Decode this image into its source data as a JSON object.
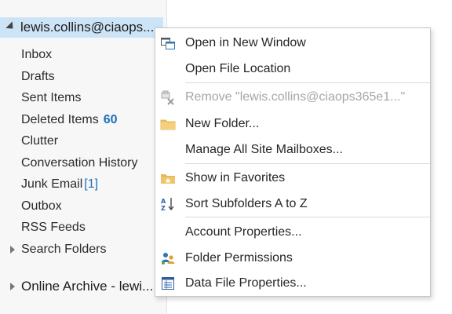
{
  "account": {
    "name": "lewis.collins@ciaops..."
  },
  "folders": [
    {
      "label": "Inbox",
      "badge": "",
      "badge_style": ""
    },
    {
      "label": "Drafts",
      "badge": "",
      "badge_style": ""
    },
    {
      "label": "Sent Items",
      "badge": "",
      "badge_style": ""
    },
    {
      "label": "Deleted Items",
      "badge": "60",
      "badge_style": "bold"
    },
    {
      "label": "Clutter",
      "badge": "",
      "badge_style": ""
    },
    {
      "label": "Conversation History",
      "badge": "",
      "badge_style": ""
    },
    {
      "label": "Junk Email",
      "badge": "[1]",
      "badge_style": "bracket"
    },
    {
      "label": "Outbox",
      "badge": "",
      "badge_style": ""
    },
    {
      "label": "RSS Feeds",
      "badge": "",
      "badge_style": ""
    },
    {
      "label": "Search Folders",
      "badge": "",
      "badge_style": ""
    }
  ],
  "archive": {
    "name": "Online Archive - lewi..."
  },
  "context_menu": {
    "items": [
      {
        "label": "Open in New Window",
        "icon": "new-window-icon",
        "disabled": false
      },
      {
        "label": "Open File Location",
        "icon": "",
        "disabled": false
      },
      {
        "label": "Remove \"lewis.collins@ciaops365e1...\"",
        "icon": "remove-mailbox-icon",
        "disabled": true
      },
      {
        "label": "New Folder...",
        "icon": "folder-icon",
        "disabled": false
      },
      {
        "label": "Manage All Site Mailboxes...",
        "icon": "",
        "disabled": false
      },
      {
        "label": "Show in Favorites",
        "icon": "favorites-folder-icon",
        "disabled": false
      },
      {
        "label": "Sort Subfolders A to Z",
        "icon": "sort-az-icon",
        "disabled": false
      },
      {
        "label": "Account Properties...",
        "icon": "",
        "disabled": false
      },
      {
        "label": "Folder Permissions",
        "icon": "people-icon",
        "disabled": false
      },
      {
        "label": "Data File Properties...",
        "icon": "properties-sheet-icon",
        "disabled": false
      }
    ]
  },
  "colors": {
    "selected_bg": "#cde4f7",
    "count_blue": "#1f6fb8",
    "pane_bg": "#f7f7f7",
    "disabled_text": "#a6a6a6"
  }
}
